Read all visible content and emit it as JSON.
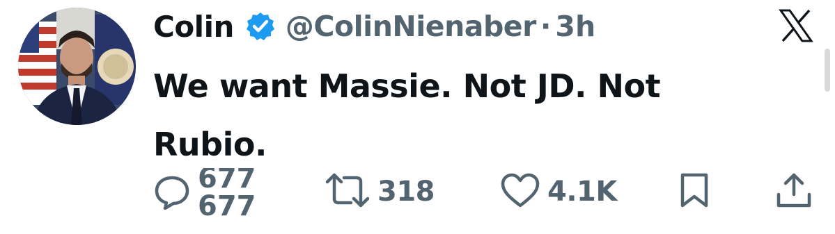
{
  "author": {
    "name": "Colin",
    "handle": "@ColinNienaber",
    "separator": "·",
    "time": "3h",
    "verified": true
  },
  "tweet": {
    "text": "We want Massie. Not JD. Not Rubio."
  },
  "actions": {
    "replies_current": "677",
    "replies_next": "677",
    "reposts": "318",
    "likes": "4.1K"
  },
  "icons": {
    "verified": "verified-badge-icon",
    "logo": "x-logo-icon",
    "reply": "reply-icon",
    "repost": "repost-icon",
    "like": "heart-icon",
    "bookmark": "bookmark-icon",
    "share": "share-icon"
  },
  "colors": {
    "text": "#0f1419",
    "secondary": "#536471",
    "verified_blue": "#1d9bf0"
  }
}
